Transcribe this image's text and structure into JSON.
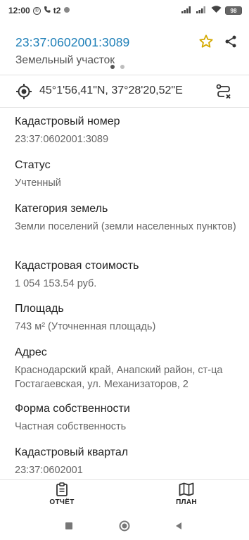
{
  "status_bar": {
    "time": "12:00",
    "badge": "®",
    "carrier": "t2",
    "battery": "98"
  },
  "header": {
    "title": "23:37:0602001:3089",
    "subtitle": "Земельный участок"
  },
  "coordinates": "45°1'56,41\"N, 37°28'20,52\"E",
  "fields": [
    {
      "label": "Кадастровый номер",
      "value": "23:37:0602001:3089"
    },
    {
      "label": "Статус",
      "value": "Учтенный"
    },
    {
      "label": "Категория земель",
      "value": "Земли поселений (земли населенных пунктов)"
    },
    {
      "label": "Кадастровая стоимость",
      "value": "1 054 153.54 руб."
    },
    {
      "label": "Площадь",
      "value": "743 м² (Уточненная площадь)"
    },
    {
      "label": "Адрес",
      "value": "Краснодарский край, Анапский район, ст-ца Гостагаевская, ул. Механизаторов, 2"
    },
    {
      "label": "Форма собственности",
      "value": "Частная собственность"
    },
    {
      "label": "Кадастровый квартал",
      "value": "23:37:0602001"
    }
  ],
  "bottom_nav": {
    "report_label": "ОТЧЁТ",
    "plan_label": "ПЛАН"
  },
  "colors": {
    "accent": "#1e7fb8",
    "star": "#d4a900"
  },
  "icons": {
    "star": "star-outline-icon",
    "share": "share-icon",
    "locate": "crosshair-icon",
    "route": "route-icon",
    "report": "clipboard-icon",
    "plan": "map-icon"
  }
}
